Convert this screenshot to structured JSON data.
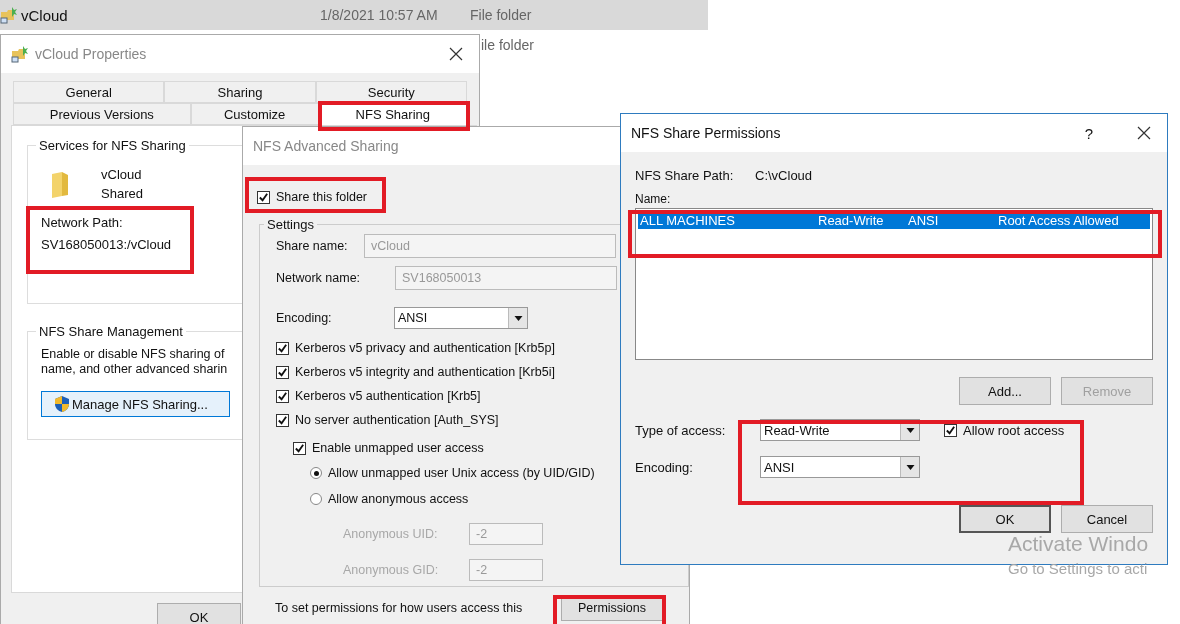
{
  "explorer": {
    "rows": [
      {
        "name": "vCloud",
        "date": "1/8/2021 10:57 AM",
        "type": "File folder",
        "selected": true
      },
      {
        "type": "ile folder",
        "selected": false
      }
    ]
  },
  "properties": {
    "title": "vCloud Properties",
    "tab_rows": [
      {
        "tabs": [
          {
            "label": "General",
            "selected": false
          },
          {
            "label": "Sharing",
            "selected": false
          },
          {
            "label": "Security",
            "selected": false
          }
        ]
      },
      {
        "tabs": [
          {
            "label": "Previous Versions",
            "selected": false
          },
          {
            "label": "Customize",
            "selected": false
          },
          {
            "label": "NFS Sharing",
            "selected": true
          }
        ]
      }
    ],
    "services": {
      "title": "Services for NFS Sharing",
      "folder_name": "vCloud",
      "folder_status": "Shared",
      "path_label": "Network Path:",
      "path": "SV168050013:/vCloud"
    },
    "management": {
      "title": "NFS Share Management",
      "lines": [
        "Enable or disable NFS sharing of",
        "name, and other advanced sharin"
      ],
      "button": "Manage NFS Sharing..."
    },
    "buttons": [
      "OK"
    ]
  },
  "advanced": {
    "title": "NFS Advanced Sharing",
    "share": {
      "label": "Share this folder",
      "checked": true
    },
    "settings_title": "Settings",
    "fields": [
      {
        "label": "Share name:",
        "value": "vCloud",
        "disabled": true
      },
      {
        "label": "Network name:",
        "value": "SV168050013",
        "disabled": true
      }
    ],
    "encoding": {
      "label": "Encoding:",
      "value": "ANSI"
    },
    "options": [
      {
        "kind": "checkbox",
        "label": "Kerberos v5 privacy and authentication [Krb5p]",
        "checked": true
      },
      {
        "kind": "checkbox",
        "label": "Kerberos v5 integrity and authentication [Krb5i]",
        "checked": true
      },
      {
        "kind": "checkbox",
        "label": "Kerberos v5 authentication [Krb5]",
        "checked": true
      },
      {
        "kind": "checkbox",
        "label": "No server authentication [Auth_SYS]",
        "checked": true,
        "children": [
          {
            "kind": "checkbox",
            "label": "Enable unmapped user access",
            "checked": true,
            "children": [
              {
                "kind": "radio",
                "label": "Allow unmapped user Unix access (by UID/GID)",
                "selected": true
              },
              {
                "kind": "radio",
                "label": "Allow anonymous access",
                "selected": false
              }
            ]
          }
        ]
      }
    ],
    "anonymous_fields": [
      {
        "label": "Anonymous UID:",
        "value": "-2",
        "disabled": true
      },
      {
        "label": "Anonymous GID:",
        "value": "-2",
        "disabled": true
      }
    ],
    "footer": "To set permissions for how users access this",
    "button": "Permissions"
  },
  "permissions": {
    "title": "NFS Share Permissions",
    "help": "?",
    "path_label": "NFS Share Path:",
    "path": "C:\\vCloud",
    "list_label": "Name:",
    "entries": [
      {
        "name": "ALL MACHINES",
        "access": "Read-Write",
        "encoding": "ANSI",
        "root": "Root Access Allowed",
        "selected": true
      }
    ],
    "list_buttons": [
      {
        "label": "Add...",
        "disabled": false
      },
      {
        "label": "Remove",
        "disabled": true
      }
    ],
    "access": {
      "label": "Type of access:",
      "value": "Read-Write"
    },
    "encoding": {
      "label": "Encoding:",
      "value": "ANSI"
    },
    "allow_root": {
      "label": "Allow root access",
      "checked": true
    },
    "buttons": [
      "OK",
      "Cancel"
    ]
  },
  "activation_notice": {
    "title": "Activate Windo",
    "text": "Go to Settings to acti"
  }
}
